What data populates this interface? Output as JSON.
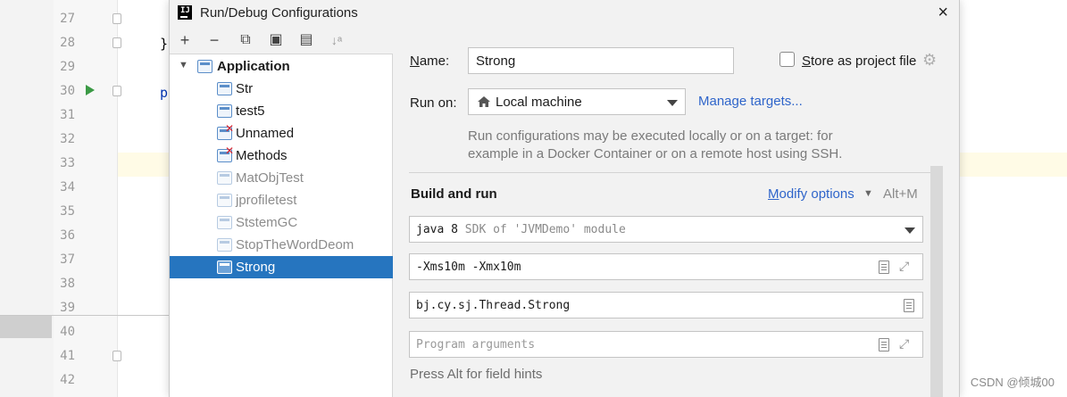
{
  "editor": {
    "line_numbers": [
      "27",
      "28",
      "29",
      "30",
      "31",
      "32",
      "33",
      "34",
      "35",
      "36",
      "37",
      "38",
      "39",
      "40",
      "41",
      "42"
    ],
    "code_fragments": {
      "brace": "}",
      "p": "p"
    }
  },
  "dialog": {
    "title": "Run/Debug Configurations",
    "app_icon_text": "IJ",
    "close_symbol": "×"
  },
  "toolbar": {
    "add": "+",
    "remove": "−",
    "copy": "⧉",
    "save": "▣",
    "new_folder": "▤",
    "sort": "↓ᵃ"
  },
  "tree": {
    "group_label": "Application",
    "items": [
      {
        "label": "Str",
        "state": "normal"
      },
      {
        "label": "test5",
        "state": "normal"
      },
      {
        "label": "Unnamed",
        "state": "error"
      },
      {
        "label": "Methods",
        "state": "error"
      },
      {
        "label": "MatObjTest",
        "state": "temporary"
      },
      {
        "label": "jprofiletest",
        "state": "temporary"
      },
      {
        "label": "StstemGC",
        "state": "temporary"
      },
      {
        "label": "StopTheWordDeom",
        "state": "temporary"
      },
      {
        "label": "Strong",
        "state": "selected"
      }
    ]
  },
  "form": {
    "name_label_mnemonic": "N",
    "name_label_rest": "ame:",
    "name_value": "Strong",
    "store_label_mnemonic": "S",
    "store_label_rest": "tore as project file",
    "store_checked": false,
    "run_on_label": "Run on:",
    "run_on_value": "Local machine",
    "manage_targets": "Manage targets...",
    "run_on_help": "Run configurations may be executed locally or on a target: for example in a Docker Container or on a remote host using SSH.",
    "build_title": "Build and run",
    "modify_options_mnemonic": "M",
    "modify_options_rest": "odify options",
    "modify_shortcut": "Alt+M",
    "sdk_main": "java 8",
    "sdk_detail": "SDK of 'JVMDemo' module",
    "vm_options": "-Xms10m -Xmx10m",
    "main_class": "bj.cy.sj.Thread.Strong",
    "program_args_placeholder": "Program arguments",
    "field_hint": "Press Alt for field hints"
  },
  "watermark": "CSDN @倾城00",
  "colors": {
    "selection": "#2675bf",
    "link": "#2f65ca",
    "error_mark": "#d9232e",
    "run_icon": "#3b9a45"
  }
}
